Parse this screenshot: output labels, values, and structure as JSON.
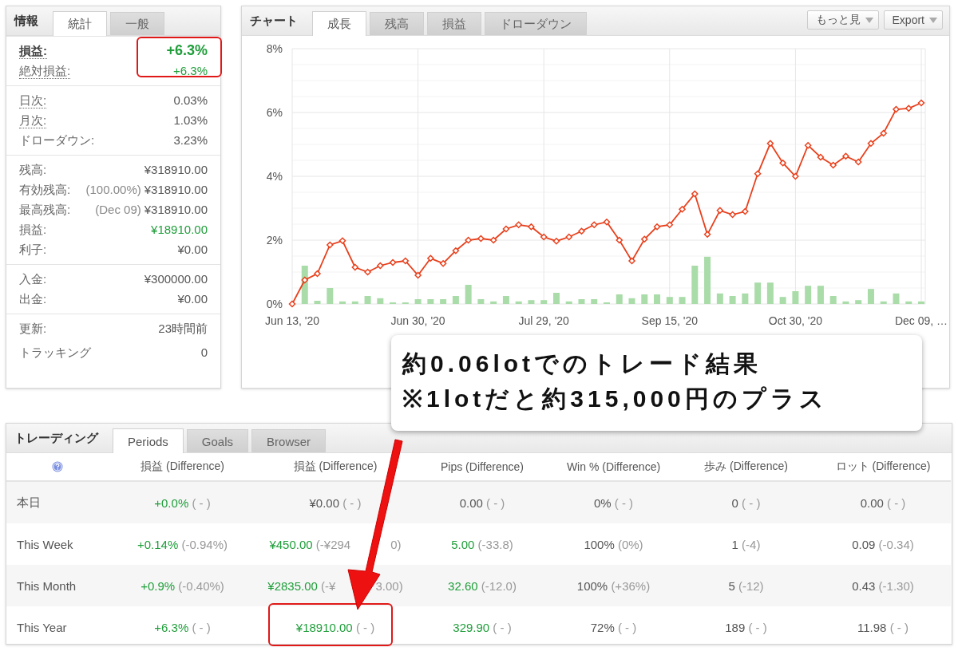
{
  "info_panel": {
    "title": "情報",
    "tabs": [
      {
        "label": "統計",
        "selected": true
      },
      {
        "label": "一般",
        "selected": false
      }
    ],
    "sections": [
      {
        "rows": [
          {
            "kind": "headline",
            "label": "損益:",
            "value": "+6.3%",
            "dotted": true,
            "positive": true
          },
          {
            "kind": "plain",
            "label": "絶対損益:",
            "value": "+6.3%",
            "dotted": true,
            "positive": true
          }
        ]
      },
      {
        "rows": [
          {
            "kind": "plain",
            "label": "日次:",
            "value": "0.03%",
            "dotted": true,
            "positive": false
          },
          {
            "kind": "plain",
            "label": "月次:",
            "value": "1.03%",
            "dotted": true,
            "positive": false
          },
          {
            "kind": "plain",
            "label": "ドローダウン:",
            "value": "3.23%",
            "dotted": false,
            "positive": false
          }
        ]
      },
      {
        "rows": [
          {
            "kind": "plain",
            "label": "残高:",
            "value": "¥318910.00",
            "dotted": false,
            "positive": false
          },
          {
            "kind": "plain",
            "label": "有効残高:",
            "note": "(100.00%)",
            "value": "¥318910.00",
            "dotted": false,
            "positive": false
          },
          {
            "kind": "plain",
            "label": "最高残高:",
            "note": "(Dec 09)",
            "value": "¥318910.00",
            "dotted": false,
            "positive": false
          },
          {
            "kind": "plain",
            "label": "損益:",
            "value": "¥18910.00",
            "dotted": false,
            "positive": true
          },
          {
            "kind": "plain",
            "label": "利子:",
            "value": "¥0.00",
            "dotted": false,
            "positive": false
          }
        ]
      },
      {
        "rows": [
          {
            "kind": "plain",
            "label": "入金:",
            "value": "¥300000.00",
            "dotted": false,
            "positive": false
          },
          {
            "kind": "plain",
            "label": "出金:",
            "value": "¥0.00",
            "dotted": false,
            "positive": false
          }
        ]
      },
      {
        "rows": [
          {
            "kind": "plain",
            "label": "更新:",
            "value": "23時間前",
            "dotted": false,
            "positive": false
          },
          {
            "kind": "tall",
            "label": "トラッキング",
            "value": "0",
            "dotted": false,
            "positive": false
          }
        ]
      }
    ]
  },
  "chart_panel": {
    "title": "チャート",
    "tabs": [
      {
        "label": "成長",
        "selected": true
      },
      {
        "label": "残高",
        "selected": false
      },
      {
        "label": "損益",
        "selected": false
      },
      {
        "label": "ドローダウン",
        "selected": false
      }
    ],
    "buttons": [
      "もっと見",
      "Export"
    ],
    "chart_data": {
      "type": "line",
      "grid": true,
      "categories": [
        "Jun 13, '20",
        null,
        null,
        null,
        null,
        null,
        null,
        null,
        null,
        null,
        "Jun 30, '20",
        null,
        null,
        null,
        null,
        null,
        null,
        null,
        null,
        null,
        "Jul 29, '20",
        null,
        null,
        null,
        null,
        null,
        null,
        null,
        null,
        null,
        "Sep 15, '20",
        null,
        null,
        null,
        null,
        null,
        null,
        null,
        null,
        null,
        "Oct 30, '20",
        null,
        null,
        null,
        null,
        null,
        null,
        null,
        null,
        null,
        "Dec 09, …"
      ],
      "ylim": [
        0,
        8
      ],
      "yticks": [
        {
          "value": 0,
          "label": "0%"
        },
        {
          "value": 2,
          "label": "2%"
        },
        {
          "value": 4,
          "label": "4%"
        },
        {
          "value": 6,
          "label": "6%"
        },
        {
          "value": 8,
          "label": "8%"
        }
      ],
      "series": [
        {
          "type": "bar",
          "color": "#a9dca9",
          "values": [
            0,
            1.2,
            0.1,
            0.5,
            0.08,
            0.08,
            0.25,
            0.18,
            0.05,
            0.05,
            0.15,
            0.15,
            0.15,
            0.25,
            0.6,
            0.15,
            0.08,
            0.25,
            0.08,
            0.12,
            0.12,
            0.35,
            0.08,
            0.15,
            0.15,
            0.05,
            0.3,
            0.18,
            0.3,
            0.3,
            0.22,
            0.22,
            1.2,
            1.48,
            0.33,
            0.25,
            0.33,
            0.67,
            0.67,
            0.22,
            0.4,
            0.57,
            0.57,
            0.25,
            0.08,
            0.12,
            0.47,
            0.08,
            0.33,
            0.08,
            0.08
          ]
        },
        {
          "type": "line",
          "color": "#e8401c",
          "marker": true,
          "values": [
            0,
            0.75,
            0.95,
            1.85,
            1.98,
            1.15,
            1.0,
            1.2,
            1.3,
            1.35,
            0.9,
            1.43,
            1.27,
            1.67,
            2.0,
            2.05,
            2.0,
            2.35,
            2.48,
            2.42,
            2.1,
            1.97,
            2.1,
            2.28,
            2.48,
            2.57,
            2.0,
            1.35,
            2.03,
            2.42,
            2.48,
            2.97,
            3.45,
            2.18,
            2.93,
            2.8,
            2.9,
            4.08,
            5.03,
            4.42,
            4.0,
            4.97,
            4.6,
            4.35,
            4.63,
            4.45,
            5.03,
            5.35,
            6.1,
            6.13,
            6.3
          ]
        }
      ]
    }
  },
  "trading_panel": {
    "title": "トレーディング",
    "tabs": [
      {
        "label": "Periods",
        "selected": true
      },
      {
        "label": "Goals",
        "selected": false
      },
      {
        "label": "Browser",
        "selected": false
      }
    ],
    "table": {
      "columns": [
        "損益 (Difference)",
        "損益 (Difference)",
        "Pips (Difference)",
        "Win % (Difference)",
        "歩み (Difference)",
        "ロット (Difference)"
      ],
      "rows": [
        {
          "label": "本日",
          "cells": [
            {
              "value": "+0.0%",
              "diff": "( - )",
              "positive": true
            },
            {
              "value": "¥0.00",
              "diff": "( - )",
              "positive": false
            },
            {
              "value": "0.00",
              "diff": "( - )",
              "positive": false
            },
            {
              "value": "0%",
              "diff": "( - )",
              "positive": false
            },
            {
              "value": "0",
              "diff": "( - )",
              "positive": false
            },
            {
              "value": "0.00",
              "diff": "( - )",
              "positive": false
            }
          ]
        },
        {
          "label": "This Week",
          "cells": [
            {
              "value": "+0.14%",
              "diff": "(-0.94%)",
              "positive": true
            },
            {
              "value": "¥450.00",
              "diff": "(-¥294",
              "diff_end": "0)",
              "positive": true
            },
            {
              "value": "5.00",
              "diff": "(-33.8)",
              "positive": true
            },
            {
              "value": "100%",
              "diff": "(0%)",
              "positive": false
            },
            {
              "value": "1",
              "diff": "(-4)",
              "positive": false
            },
            {
              "value": "0.09",
              "diff": "(-0.34)",
              "positive": false
            }
          ]
        },
        {
          "label": "This Month",
          "cells": [
            {
              "value": "+0.9%",
              "diff": "(-0.40%)",
              "positive": true
            },
            {
              "value": "¥2835.00",
              "diff": "(-¥",
              "diff_end": "3.00)",
              "positive": true
            },
            {
              "value": "32.60",
              "diff": "(-12.0)",
              "positive": true
            },
            {
              "value": "100%",
              "diff": "(+36%)",
              "positive": false
            },
            {
              "value": "5",
              "diff": "(-12)",
              "positive": false
            },
            {
              "value": "0.43",
              "diff": "(-1.30)",
              "positive": false
            }
          ]
        },
        {
          "label": "This Year",
          "cells": [
            {
              "value": "+6.3%",
              "diff": "( - )",
              "positive": true
            },
            {
              "value": "¥18910.00",
              "diff": "( - )",
              "positive": true
            },
            {
              "value": "329.90",
              "diff": "( - )",
              "positive": true
            },
            {
              "value": "72%",
              "diff": "( - )",
              "positive": false
            },
            {
              "value": "189",
              "diff": "( - )",
              "positive": false
            },
            {
              "value": "11.98",
              "diff": "( - )",
              "positive": false
            }
          ]
        }
      ]
    }
  },
  "callout": {
    "lines": [
      "約0.06lotでのトレード結果",
      "※1lotだと約315,000円のプラス"
    ]
  }
}
